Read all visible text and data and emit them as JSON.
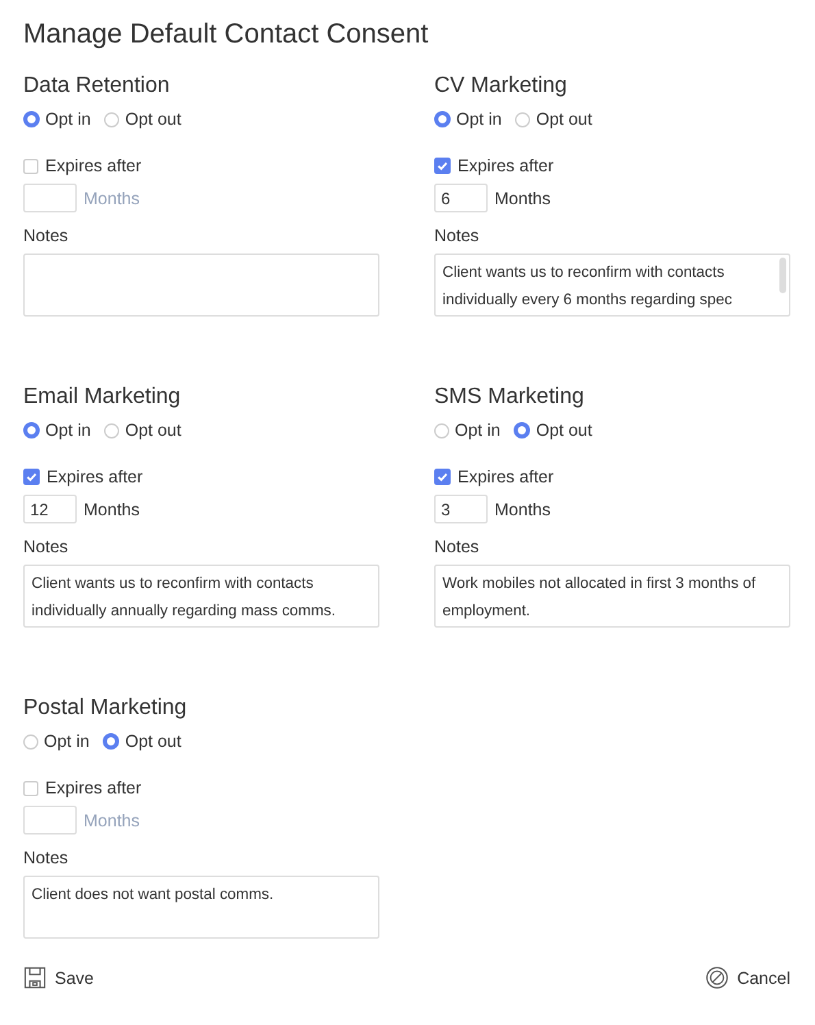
{
  "title": "Manage Default Contact Consent",
  "sections": [
    {
      "name": "Data Retention",
      "options": [
        {
          "label": "Opt in",
          "selected": true
        },
        {
          "label": "Opt out",
          "selected": false
        }
      ],
      "expires_label": "Expires after",
      "expires_checked": false,
      "months_label": "Months",
      "notes_label": "Notes",
      "scrollable": false
    },
    {
      "name": "CV Marketing",
      "options": [
        {
          "label": "Opt in",
          "selected": true
        },
        {
          "label": "Opt out",
          "selected": false
        }
      ],
      "expires_label": "Expires after",
      "expires_checked": true,
      "months_value": "6",
      "months_label": "Months",
      "notes_label": "Notes",
      "notes": "Client wants us to reconfirm with contacts individually every 6 months regarding spec",
      "scrollable": true
    },
    {
      "name": "Email Marketing",
      "options": [
        {
          "label": "Opt in",
          "selected": true
        },
        {
          "label": "Opt out",
          "selected": false
        }
      ],
      "expires_label": "Expires after",
      "expires_checked": true,
      "months_value": "12",
      "months_label": "Months",
      "notes_label": "Notes",
      "notes": "Client wants us to reconfirm with contacts individually annually regarding mass comms.",
      "scrollable": false
    },
    {
      "name": "SMS Marketing",
      "options": [
        {
          "label": "Opt in",
          "selected": false
        },
        {
          "label": "Opt out",
          "selected": true
        }
      ],
      "expires_label": "Expires after",
      "expires_checked": true,
      "months_value": "3",
      "months_label": "Months",
      "notes_label": "Notes",
      "notes": "Work mobiles not allocated in first 3 months of employment.",
      "scrollable": false
    },
    {
      "name": "Postal Marketing",
      "options": [
        {
          "label": "Opt in",
          "selected": false
        },
        {
          "label": "Opt out",
          "selected": true
        }
      ],
      "expires_label": "Expires after",
      "expires_checked": false,
      "months_label": "Months",
      "notes_label": "Notes",
      "notes": "Client does not want postal comms.",
      "scrollable": false
    }
  ],
  "save": "Save",
  "cancel": "Cancel"
}
